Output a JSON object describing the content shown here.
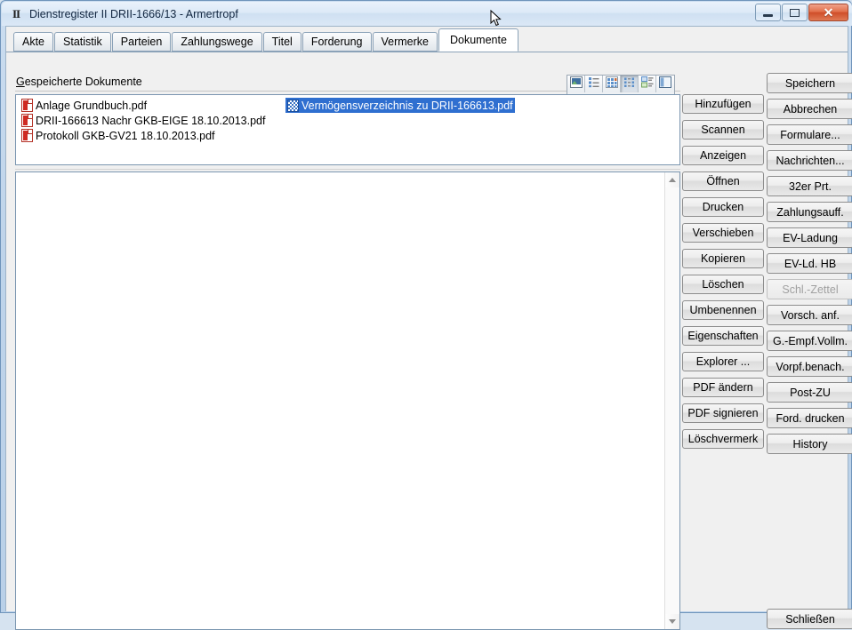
{
  "window": {
    "icon": "ii-glyph-icon",
    "title": "Dienstregister II DRII-1666/13 - Armertropf",
    "controls": {
      "minimize": "minimize-icon",
      "restore": "restore-icon",
      "close": "✕"
    }
  },
  "tabs": [
    {
      "label": "Akte",
      "active": false
    },
    {
      "label": "Statistik",
      "active": false
    },
    {
      "label": "Parteien",
      "active": false
    },
    {
      "label": "Zahlungswege",
      "active": false
    },
    {
      "label": "Titel",
      "active": false
    },
    {
      "label": "Forderung",
      "active": false
    },
    {
      "label": "Vermerke",
      "active": false
    },
    {
      "label": "Dokumente",
      "active": true
    }
  ],
  "group": {
    "label_accel": "G",
    "label_rest": "espeicherte Dokumente"
  },
  "viewbar": {
    "buttons": [
      {
        "name": "thumbnails-view-icon",
        "pressed": false
      },
      {
        "name": "tiles-view-icon",
        "pressed": false
      },
      {
        "name": "icons-view-icon",
        "pressed": false
      },
      {
        "name": "list-view-icon",
        "pressed": true
      },
      {
        "name": "details-view-icon",
        "pressed": false
      },
      {
        "name": "preview-pane-icon",
        "pressed": false
      }
    ]
  },
  "documents": {
    "left_column": [
      {
        "icon": "pdf-file-icon",
        "name": "Anlage Grundbuch.pdf",
        "selected": false
      },
      {
        "icon": "pdf-file-icon",
        "name": "DRII-166613 Nachr GKB-EIGE 18.10.2013.pdf",
        "selected": false
      },
      {
        "icon": "pdf-file-icon",
        "name": "Protokoll GKB-GV21 18.10.2013.pdf",
        "selected": false
      }
    ],
    "right_column": [
      {
        "icon": "selected-file-icon",
        "name": "Vermögensverzeichnis zu DRII-166613.pdf",
        "selected": true
      }
    ]
  },
  "action_buttons": [
    {
      "label": "Hinzufügen",
      "disabled": false
    },
    {
      "label": "Scannen",
      "disabled": false
    },
    {
      "label": "Anzeigen",
      "disabled": false
    },
    {
      "label": "Öffnen",
      "disabled": false
    },
    {
      "label": "Drucken",
      "disabled": false
    },
    {
      "label": "Verschieben",
      "disabled": false
    },
    {
      "label": "Kopieren",
      "disabled": false
    },
    {
      "label": "Löschen",
      "disabled": false
    },
    {
      "label": "Umbenennen",
      "disabled": false
    },
    {
      "label": "Eigenschaften",
      "disabled": false
    },
    {
      "label": "Explorer ...",
      "disabled": false
    },
    {
      "label": "PDF ändern",
      "disabled": false
    },
    {
      "label": "PDF signieren",
      "disabled": false
    },
    {
      "label": "Löschvermerk",
      "disabled": false
    }
  ],
  "side_buttons": [
    {
      "label": "Speichern",
      "disabled": false
    },
    {
      "label": "Abbrechen",
      "disabled": false
    },
    {
      "label": "Formulare...",
      "disabled": false
    },
    {
      "label": "Nachrichten...",
      "disabled": false
    },
    {
      "label": "32er Prt.",
      "disabled": false
    },
    {
      "label": "Zahlungsauff.",
      "disabled": false
    },
    {
      "label": "EV-Ladung",
      "disabled": false
    },
    {
      "label": "EV-Ld. HB",
      "disabled": false
    },
    {
      "label": "Schl.-Zettel",
      "disabled": true
    },
    {
      "label": "Vorsch. anf.",
      "disabled": false
    },
    {
      "label": "G.-Empf.Vollm.",
      "disabled": false
    },
    {
      "label": "Vorpf.benach.",
      "disabled": false
    },
    {
      "label": "Post-ZU",
      "disabled": false
    },
    {
      "label": "Ford. drucken",
      "disabled": false
    },
    {
      "label": "History",
      "disabled": false
    }
  ],
  "close_button": {
    "label": "Schließen"
  },
  "colors": {
    "selection": "#2f6fd0",
    "pdf_red": "#cf2a22",
    "close_red": "#cf4e29",
    "frame": "#b9d0e8"
  }
}
